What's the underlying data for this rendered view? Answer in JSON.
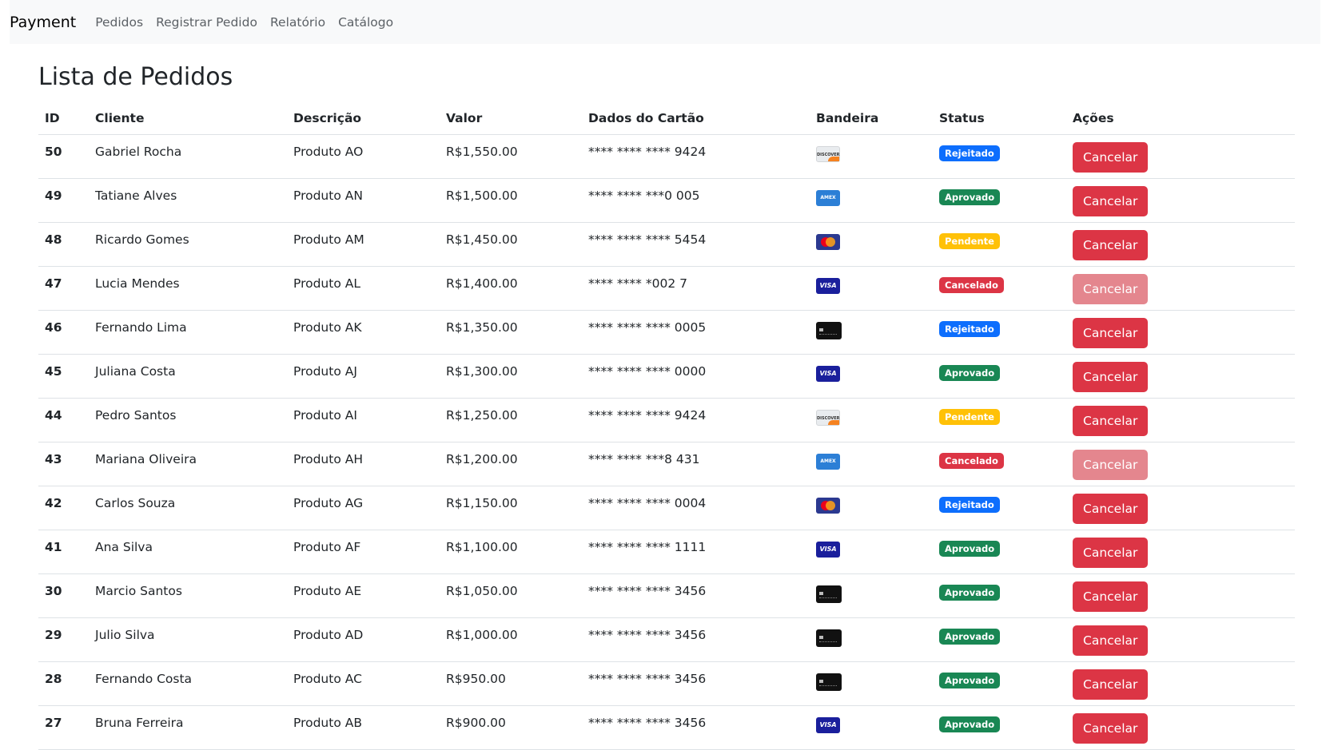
{
  "navbar": {
    "brand": "Payment",
    "links": [
      "Pedidos",
      "Registrar Pedido",
      "Relatório",
      "Catálogo"
    ]
  },
  "page": {
    "title": "Lista de Pedidos"
  },
  "table": {
    "headers": [
      "ID",
      "Cliente",
      "Descrição",
      "Valor",
      "Dados do Cartão",
      "Bandeira",
      "Status",
      "Ações"
    ],
    "rows": [
      {
        "id": "50",
        "cliente": "Gabriel Rocha",
        "descricao": "Produto AO",
        "valor": "R$1,550.00",
        "cartao": "**** **** **** 9424",
        "bandeira": "discover",
        "status": "Rejeitado",
        "acao": "Cancelar",
        "acao_enabled": true
      },
      {
        "id": "49",
        "cliente": "Tatiane Alves",
        "descricao": "Produto AN",
        "valor": "R$1,500.00",
        "cartao": "**** **** ***0 005",
        "bandeira": "amex",
        "status": "Aprovado",
        "acao": "Cancelar",
        "acao_enabled": true
      },
      {
        "id": "48",
        "cliente": "Ricardo Gomes",
        "descricao": "Produto AM",
        "valor": "R$1,450.00",
        "cartao": "**** **** **** 5454",
        "bandeira": "mastercard",
        "status": "Pendente",
        "acao": "Cancelar",
        "acao_enabled": true
      },
      {
        "id": "47",
        "cliente": "Lucia Mendes",
        "descricao": "Produto AL",
        "valor": "R$1,400.00",
        "cartao": "**** **** *002 7",
        "bandeira": "visa",
        "status": "Cancelado",
        "acao": "Cancelar",
        "acao_enabled": false
      },
      {
        "id": "46",
        "cliente": "Fernando Lima",
        "descricao": "Produto AK",
        "valor": "R$1,350.00",
        "cartao": "**** **** **** 0005",
        "bandeira": "generic",
        "status": "Rejeitado",
        "acao": "Cancelar",
        "acao_enabled": true
      },
      {
        "id": "45",
        "cliente": "Juliana Costa",
        "descricao": "Produto AJ",
        "valor": "R$1,300.00",
        "cartao": "**** **** **** 0000",
        "bandeira": "visa",
        "status": "Aprovado",
        "acao": "Cancelar",
        "acao_enabled": true
      },
      {
        "id": "44",
        "cliente": "Pedro Santos",
        "descricao": "Produto AI",
        "valor": "R$1,250.00",
        "cartao": "**** **** **** 9424",
        "bandeira": "discover",
        "status": "Pendente",
        "acao": "Cancelar",
        "acao_enabled": true
      },
      {
        "id": "43",
        "cliente": "Mariana Oliveira",
        "descricao": "Produto AH",
        "valor": "R$1,200.00",
        "cartao": "**** **** ***8 431",
        "bandeira": "amex",
        "status": "Cancelado",
        "acao": "Cancelar",
        "acao_enabled": false
      },
      {
        "id": "42",
        "cliente": "Carlos Souza",
        "descricao": "Produto AG",
        "valor": "R$1,150.00",
        "cartao": "**** **** **** 0004",
        "bandeira": "mastercard",
        "status": "Rejeitado",
        "acao": "Cancelar",
        "acao_enabled": true
      },
      {
        "id": "41",
        "cliente": "Ana Silva",
        "descricao": "Produto AF",
        "valor": "R$1,100.00",
        "cartao": "**** **** **** 1111",
        "bandeira": "visa",
        "status": "Aprovado",
        "acao": "Cancelar",
        "acao_enabled": true
      },
      {
        "id": "30",
        "cliente": "Marcio Santos",
        "descricao": "Produto AE",
        "valor": "R$1,050.00",
        "cartao": "**** **** **** 3456",
        "bandeira": "generic",
        "status": "Aprovado",
        "acao": "Cancelar",
        "acao_enabled": true
      },
      {
        "id": "29",
        "cliente": "Julio Silva",
        "descricao": "Produto AD",
        "valor": "R$1,000.00",
        "cartao": "**** **** **** 3456",
        "bandeira": "generic",
        "status": "Aprovado",
        "acao": "Cancelar",
        "acao_enabled": true
      },
      {
        "id": "28",
        "cliente": "Fernando Costa",
        "descricao": "Produto AC",
        "valor": "R$950.00",
        "cartao": "**** **** **** 3456",
        "bandeira": "generic",
        "status": "Aprovado",
        "acao": "Cancelar",
        "acao_enabled": true
      },
      {
        "id": "27",
        "cliente": "Bruna Ferreira",
        "descricao": "Produto AB",
        "valor": "R$900.00",
        "cartao": "**** **** **** 3456",
        "bandeira": "visa",
        "status": "Aprovado",
        "acao": "Cancelar",
        "acao_enabled": true
      }
    ]
  },
  "colors": {
    "rejeitado": "#0d6efd",
    "aprovado": "#198754",
    "pendente": "#ffc107",
    "cancelado": "#dc3545",
    "button_danger": "#dc3545",
    "button_disabled": "#e4868e"
  },
  "card_brand_labels": {
    "visa": "VISA",
    "amex": "AMEX",
    "discover": "DISCOVER"
  }
}
